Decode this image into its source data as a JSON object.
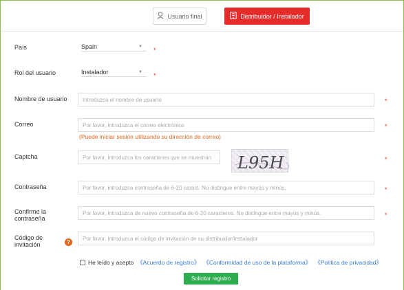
{
  "tabs": {
    "user_label": "Usuario final",
    "distributor_label": "Distribuidor / Instalador"
  },
  "form": {
    "country": {
      "label": "País",
      "value": "Spain"
    },
    "role": {
      "label": "Rol del usuario",
      "value": "Instalador"
    },
    "username": {
      "label": "Nombre de usuario",
      "placeholder": "Introduzca el nombre de usuario"
    },
    "email": {
      "label": "Correo",
      "placeholder": "Por favor, introduzca el correo electrónico",
      "hint": "(Puede iniciar sesión utilizando su dirección de correo)"
    },
    "captcha": {
      "label": "Captcha",
      "placeholder": "Por favor, introduzca los caracteres que se muestran",
      "image_text": "L95H"
    },
    "password": {
      "label": "Contraseña",
      "placeholder": "Por favor, introduzca contraseña de 6-20 caract. No distingue entre mayús y minús."
    },
    "confirm_password": {
      "label_line1": "Confirme la",
      "label_line2": "contraseña",
      "placeholder": "Por favor, introduzca de nuevo contraseña de 6-20 caracteres. No distingue entre mayús y minús."
    },
    "invite_code": {
      "label_line1": "Código de",
      "label_line2": "invitación",
      "placeholder": "Por favor, introduzca el código de invitación de su distribuidor/instalador"
    },
    "required_mark": "*",
    "help_mark": "?"
  },
  "terms": {
    "text": "He leído y acepto",
    "link1": "《Acuerdo de registro》",
    "link2": "《Conformidad de uso de la plataforma》",
    "link3": "《Política de privacidad》"
  },
  "submit_label": "Solicitar registro",
  "colors": {
    "accent_red": "#e62b2b",
    "submit_green": "#2eac4f",
    "hint_orange": "#e0661b",
    "link_blue": "#3a7bd5"
  },
  "icons": {
    "user_tab": "user-icon",
    "distributor_tab": "building-icon",
    "help": "question-icon"
  }
}
